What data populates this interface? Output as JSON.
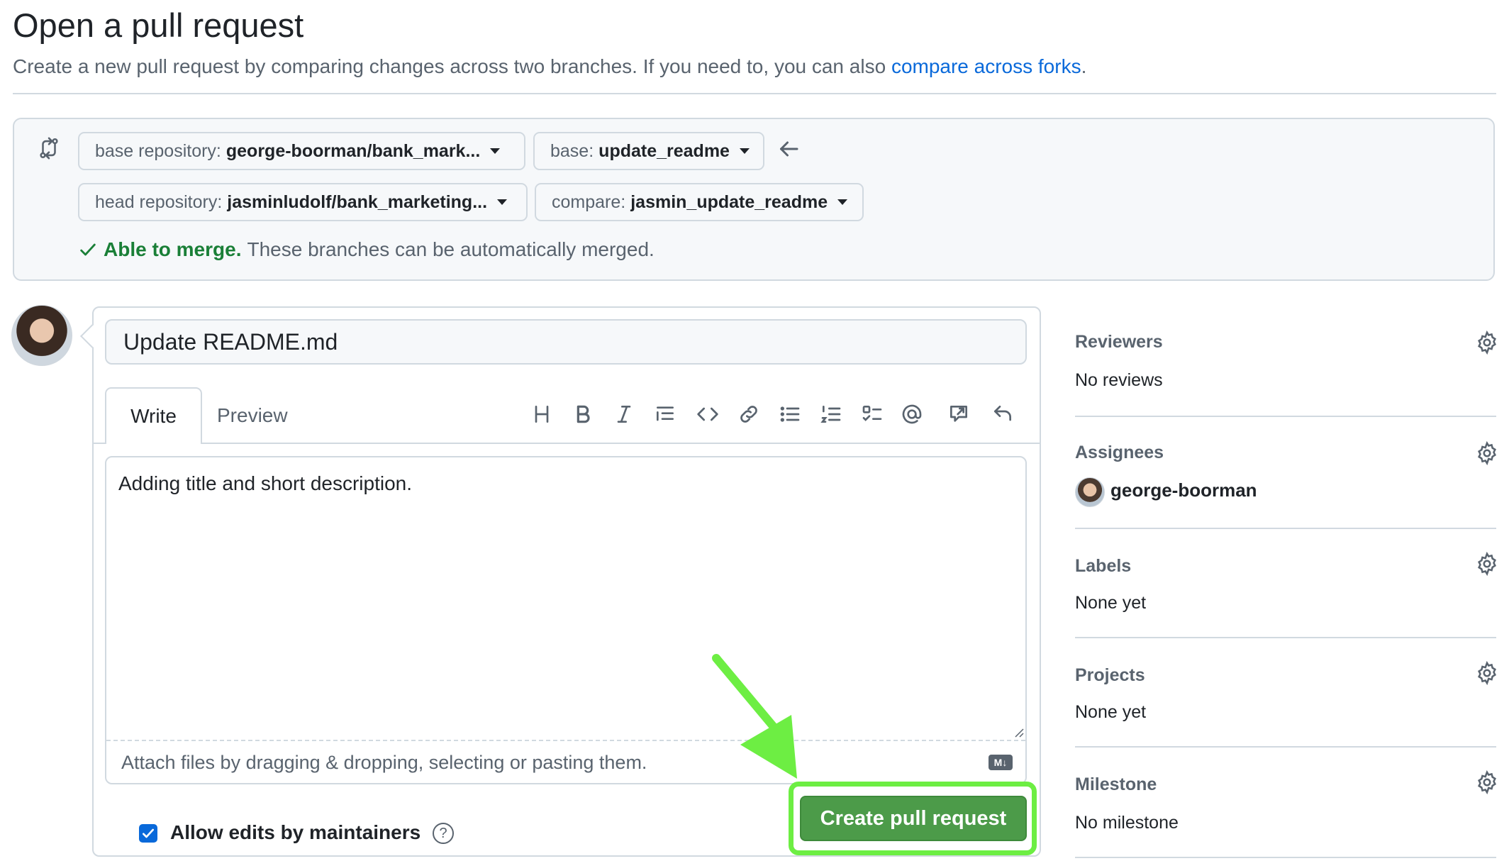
{
  "page": {
    "title": "Open a pull request",
    "subtitle": "Create a new pull request by comparing changes across two branches. If you need to, you can also ",
    "subtitle_link": "compare across forks",
    "subtitle_end": "."
  },
  "compare": {
    "base_repo_label": "base repository:",
    "base_repo_value": "george-boorman/bank_mark...",
    "base_label": "base:",
    "base_value": "update_readme",
    "head_repo_label": "head repository:",
    "head_repo_value": "jasminludolf/bank_marketing...",
    "compare_label": "compare:",
    "compare_value": "jasmin_update_readme",
    "merge_status": "Able to merge.",
    "merge_detail": "These branches can be automatically merged."
  },
  "editor": {
    "title_value": "Update README.md",
    "tab_write": "Write",
    "tab_preview": "Preview",
    "toolbar_icons": [
      "heading-icon",
      "bold-icon",
      "italic-icon",
      "quote-icon",
      "code-icon",
      "link-icon",
      "unordered-list-icon",
      "ordered-list-icon",
      "task-list-icon",
      "mention-icon",
      "reference-icon",
      "undo-icon"
    ],
    "body_text": "Adding title and short description.",
    "attach_hint": "Attach files by dragging & dropping, selecting or pasting them.",
    "markdown_badge": "M↓",
    "allow_edits_label": "Allow edits by maintainers",
    "allow_edits_checked": true,
    "help_glyph": "?",
    "create_button": "Create pull request",
    "highlight_color": "#6dee43"
  },
  "sidebar": {
    "reviewers_label": "Reviewers",
    "reviewers_value": "No reviews",
    "assignees_label": "Assignees",
    "assignee_name": "george-boorman",
    "labels_label": "Labels",
    "labels_value": "None yet",
    "projects_label": "Projects",
    "projects_value": "None yet",
    "milestone_label": "Milestone",
    "milestone_value": "No milestone"
  },
  "colors": {
    "link": "#0969da",
    "success": "#1a7f37",
    "button": "#4c9b49",
    "muted": "#59636e"
  }
}
